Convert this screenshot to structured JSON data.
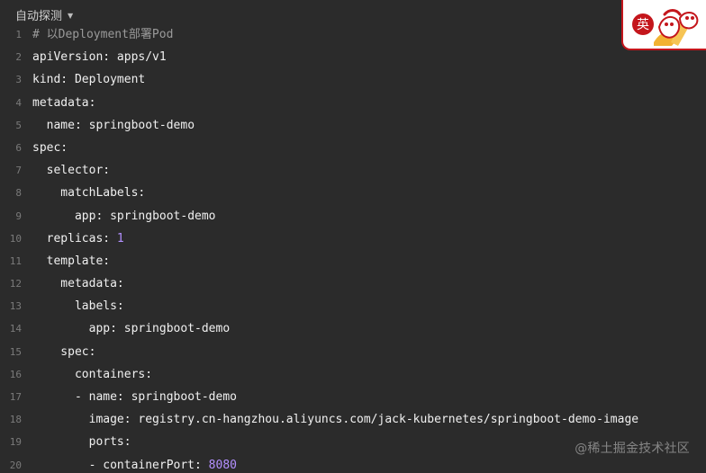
{
  "language_selector": {
    "label": "自动探测",
    "icon": "caret-down-icon"
  },
  "code_lines": [
    {
      "n": "1",
      "parts": [
        {
          "cls": "comment",
          "text": "# 以Deployment部署Pod"
        }
      ]
    },
    {
      "n": "2",
      "parts": [
        {
          "cls": "key",
          "text": "apiVersion:"
        },
        {
          "cls": "val",
          "text": " apps/v1"
        }
      ]
    },
    {
      "n": "3",
      "parts": [
        {
          "cls": "key",
          "text": "kind:"
        },
        {
          "cls": "val",
          "text": " Deployment"
        }
      ]
    },
    {
      "n": "4",
      "parts": [
        {
          "cls": "key",
          "text": "metadata:"
        }
      ]
    },
    {
      "n": "5",
      "parts": [
        {
          "cls": "key",
          "text": "  name:"
        },
        {
          "cls": "val",
          "text": " springboot-demo"
        }
      ]
    },
    {
      "n": "6",
      "parts": [
        {
          "cls": "key",
          "text": "spec:"
        }
      ]
    },
    {
      "n": "7",
      "parts": [
        {
          "cls": "key",
          "text": "  selector:"
        }
      ]
    },
    {
      "n": "8",
      "parts": [
        {
          "cls": "key",
          "text": "    matchLabels:"
        }
      ]
    },
    {
      "n": "9",
      "parts": [
        {
          "cls": "key",
          "text": "      app:"
        },
        {
          "cls": "val",
          "text": " springboot-demo"
        }
      ]
    },
    {
      "n": "10",
      "parts": [
        {
          "cls": "key",
          "text": "  replicas:"
        },
        {
          "cls": "num",
          "text": " 1"
        }
      ]
    },
    {
      "n": "11",
      "parts": [
        {
          "cls": "key",
          "text": "  template:"
        }
      ]
    },
    {
      "n": "12",
      "parts": [
        {
          "cls": "key",
          "text": "    metadata:"
        }
      ]
    },
    {
      "n": "13",
      "parts": [
        {
          "cls": "key",
          "text": "      labels:"
        }
      ]
    },
    {
      "n": "14",
      "parts": [
        {
          "cls": "key",
          "text": "        app:"
        },
        {
          "cls": "val",
          "text": " springboot-demo"
        }
      ]
    },
    {
      "n": "15",
      "parts": [
        {
          "cls": "key",
          "text": "    spec:"
        }
      ]
    },
    {
      "n": "16",
      "parts": [
        {
          "cls": "key",
          "text": "      containers:"
        }
      ]
    },
    {
      "n": "17",
      "parts": [
        {
          "cls": "key",
          "text": "      - name:"
        },
        {
          "cls": "val",
          "text": " springboot-demo"
        }
      ]
    },
    {
      "n": "18",
      "parts": [
        {
          "cls": "key",
          "text": "        image:"
        },
        {
          "cls": "val",
          "text": " registry.cn-hangzhou.aliyuncs.com/jack-kubernetes/springboot-demo-image"
        }
      ]
    },
    {
      "n": "19",
      "parts": [
        {
          "cls": "key",
          "text": "        ports:"
        }
      ]
    },
    {
      "n": "20",
      "parts": [
        {
          "cls": "key",
          "text": "        - containerPort:"
        },
        {
          "cls": "num",
          "text": " 8080"
        }
      ]
    }
  ],
  "ime_widget": {
    "label": "英",
    "icon": "ime-mascot-icon",
    "accent_color": "#c4161c"
  },
  "watermark": {
    "text": "@稀土掘金技术社区"
  },
  "colors": {
    "background": "#2b2b2b",
    "line_number": "#7a7a7a",
    "comment": "#9a9a9a",
    "text": "#f0f0f0",
    "number": "#b390ff"
  }
}
